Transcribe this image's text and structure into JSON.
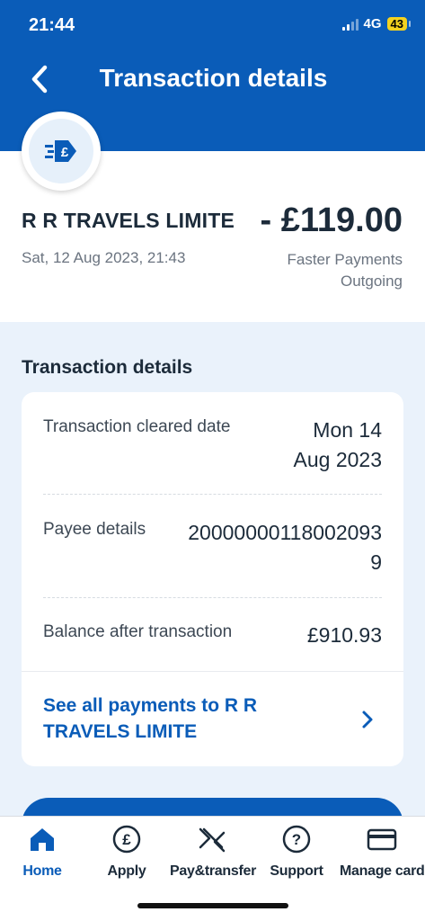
{
  "status": {
    "time": "21:44",
    "network": "4G",
    "battery": "43"
  },
  "header": {
    "title": "Transaction details"
  },
  "summary": {
    "merchant": "R R TRAVELS LIMITE",
    "amount": "- £119.00",
    "datetime": "Sat, 12 Aug 2023, 21:43",
    "payment_type_line1": "Faster Payments",
    "payment_type_line2": "Outgoing"
  },
  "details": {
    "section_title": "Transaction details",
    "rows": [
      {
        "label": "Transaction cleared date",
        "value_line1": "Mon 14",
        "value_line2": "Aug 2023"
      },
      {
        "label": "Payee details",
        "value_line1": "20000000118002093",
        "value_line2": "9"
      },
      {
        "label": "Balance after transaction",
        "value_line1": "£910.93"
      }
    ],
    "link_label": "See all payments to R R TRAVELS LIMITE"
  },
  "tabs": [
    {
      "label": "Home",
      "icon": "home-icon",
      "active": true
    },
    {
      "label": "Apply",
      "icon": "pound-circle-icon"
    },
    {
      "label": "Pay&transfer",
      "icon": "transfer-icon"
    },
    {
      "label": "Support",
      "icon": "help-icon"
    },
    {
      "label": "Manage card",
      "icon": "card-icon"
    }
  ],
  "colors": {
    "brand_blue": "#0a5cb8",
    "page_bg": "#eaf2fb",
    "battery_yellow": "#f4d21f"
  }
}
